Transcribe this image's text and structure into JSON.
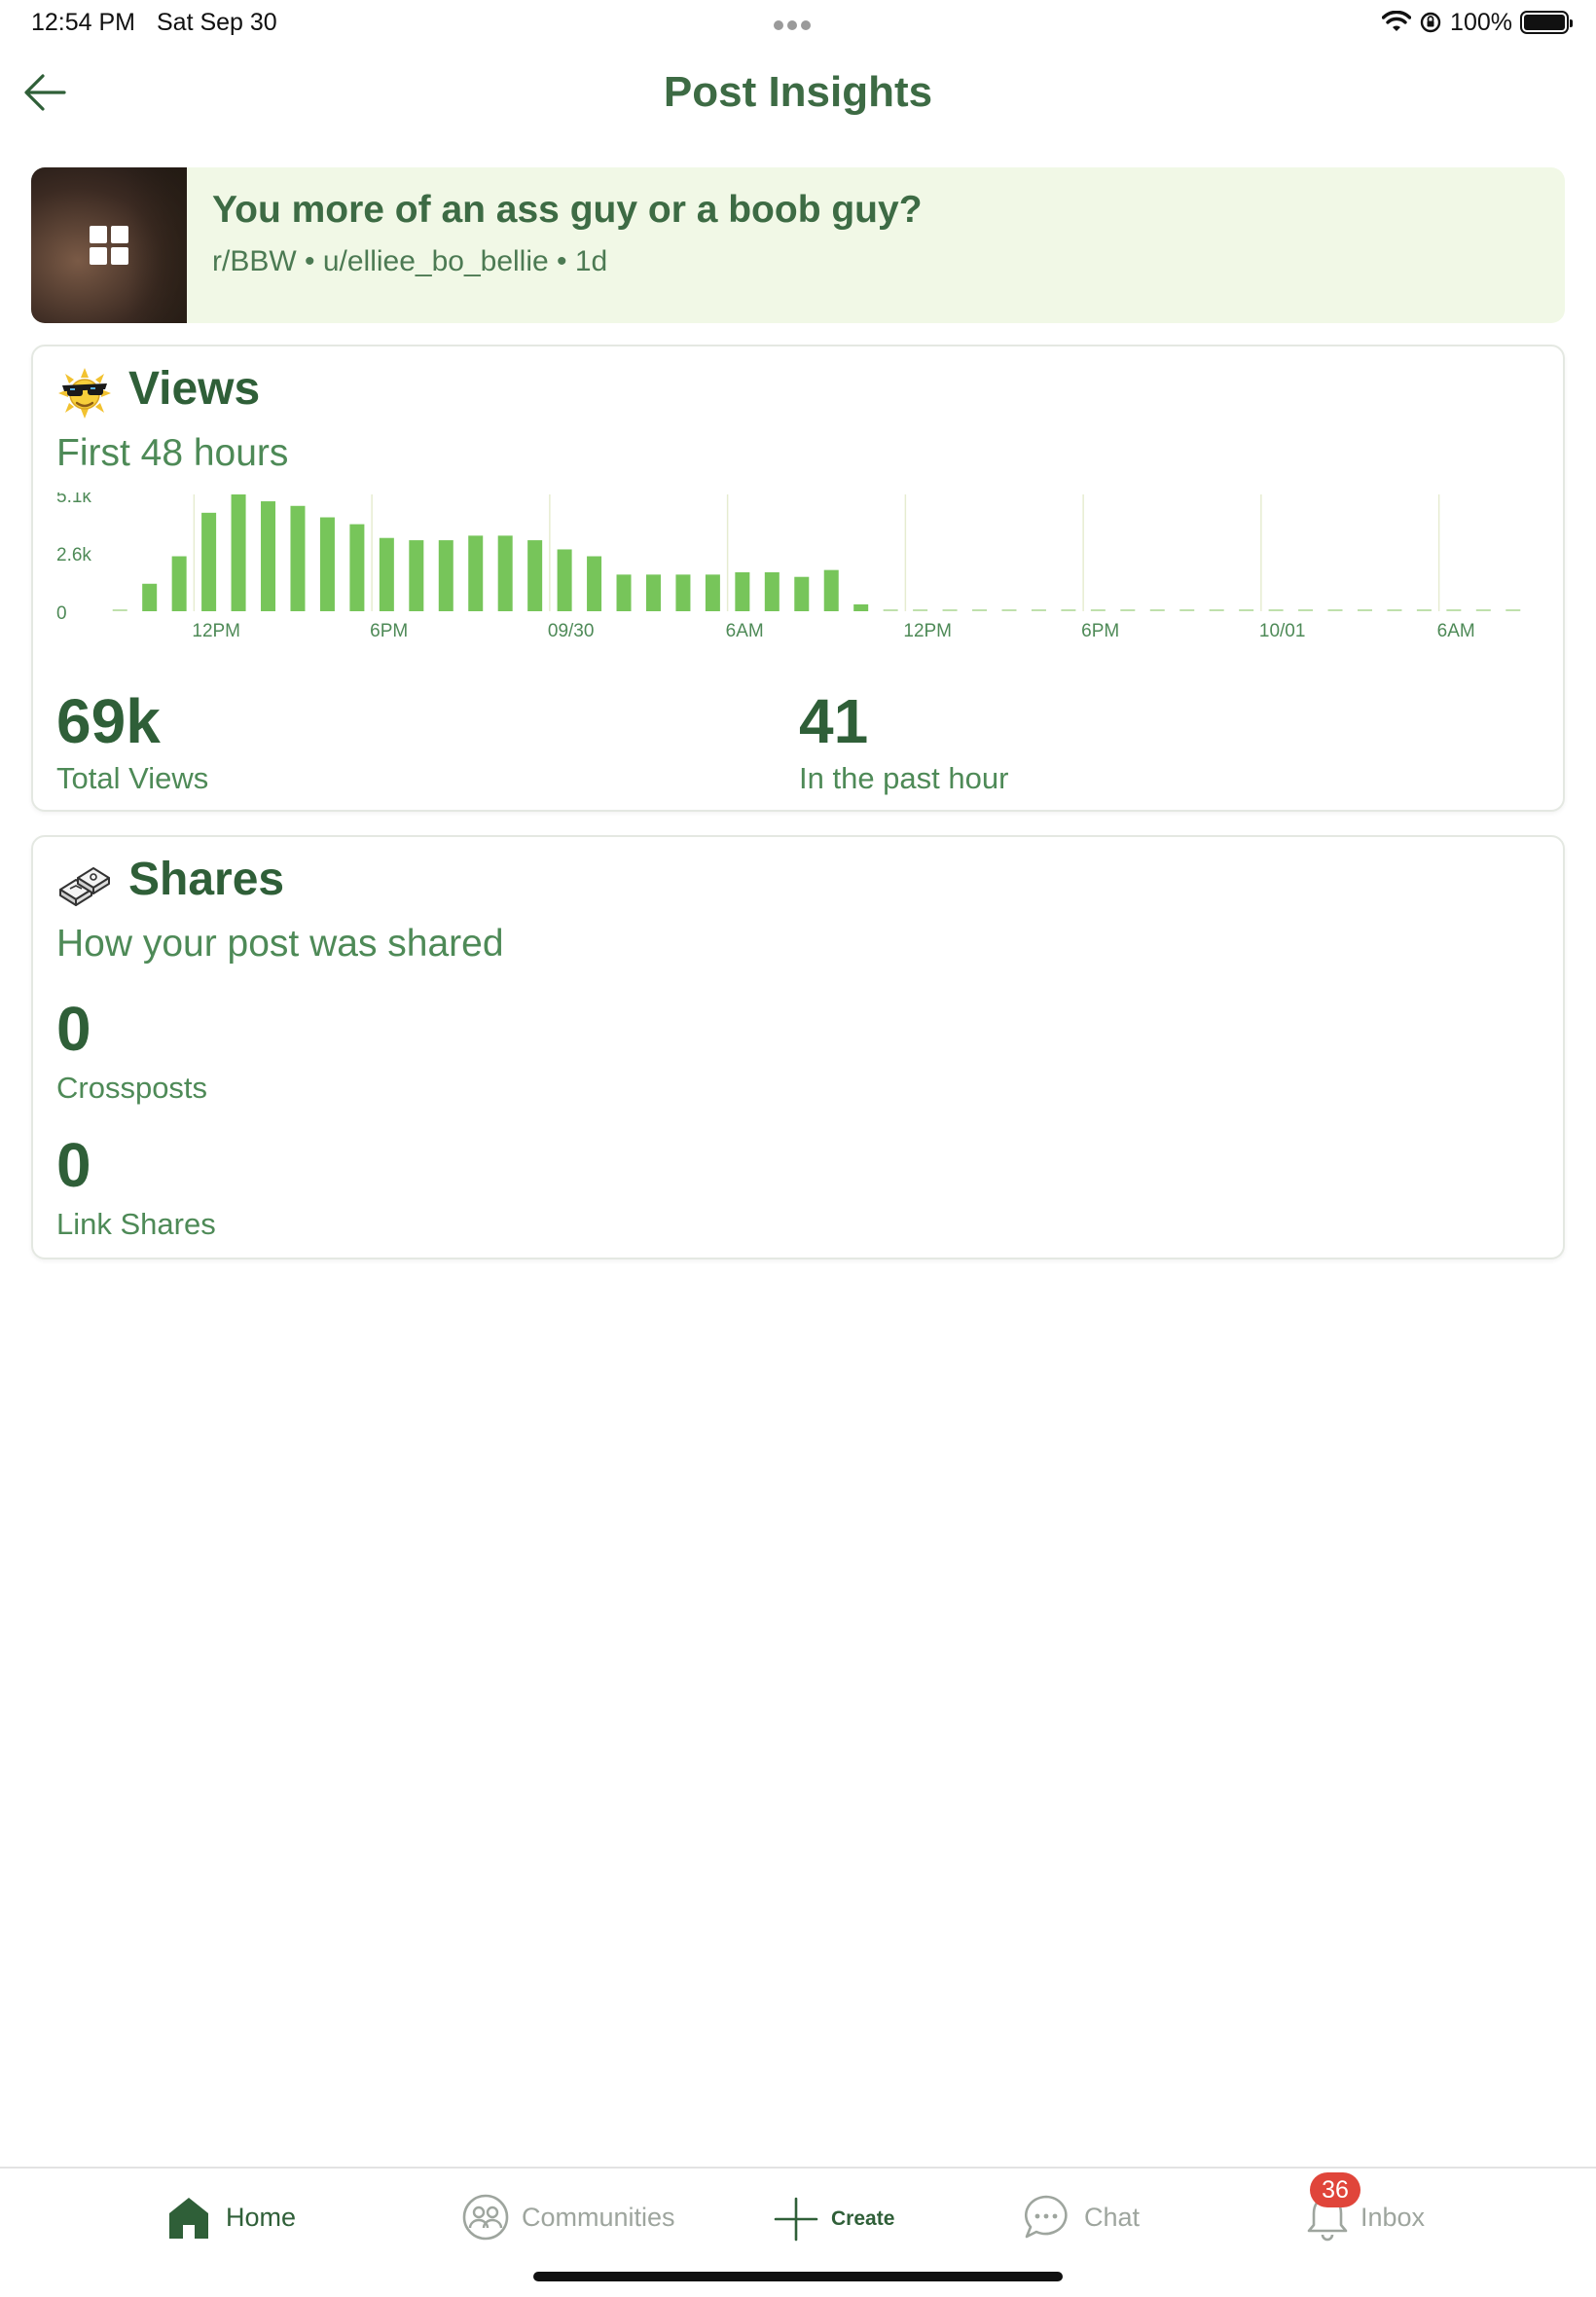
{
  "status_bar": {
    "time": "12:54 PM",
    "date": "Sat Sep 30",
    "battery_text": "100%",
    "battery_level": 1.0
  },
  "header": {
    "title": "Post Insights",
    "back_icon": "arrow-left-icon"
  },
  "post": {
    "title": "You more of an ass guy or a boob guy?",
    "meta": "r/BBW • u/elliee_bo_bellie • 1d",
    "thumbnail_icon": "gallery-icon"
  },
  "views": {
    "title": "Views",
    "subtitle": "First 48 hours",
    "total_value": "69k",
    "total_label": "Total Views",
    "past_hour_value": "41",
    "past_hour_label": "In the past hour"
  },
  "shares": {
    "title": "Shares",
    "subtitle": "How your post was shared",
    "crossposts_value": "0",
    "crossposts_label": "Crossposts",
    "link_shares_value": "0",
    "link_shares_label": "Link Shares"
  },
  "chart_data": {
    "type": "bar",
    "title": "",
    "xlabel": "",
    "ylabel": "",
    "y_ticks": [
      "5.1k",
      "2.6k",
      "0"
    ],
    "ylim": [
      0,
      5100
    ],
    "x_tick_labels": [
      "12PM",
      "6PM",
      "09/30",
      "6AM",
      "12PM",
      "6PM",
      "10/01",
      "6AM"
    ],
    "bar_color": "#77c55a",
    "values": [
      0,
      1200,
      2400,
      4300,
      5100,
      4800,
      4600,
      4100,
      3800,
      3200,
      3100,
      3100,
      3300,
      3300,
      3100,
      2700,
      2400,
      1600,
      1600,
      1600,
      1600,
      1700,
      1700,
      1500,
      1800,
      300,
      0,
      0,
      0,
      0,
      0,
      0,
      0,
      0,
      0,
      0,
      0,
      0,
      0,
      0,
      0,
      0,
      0,
      0,
      0,
      0,
      0,
      0
    ],
    "grid": "vertical"
  },
  "nav": {
    "items": [
      {
        "label": "Home",
        "icon": "home-icon"
      },
      {
        "label": "Communities",
        "icon": "communities-icon"
      },
      {
        "label": "Create",
        "icon": "plus-icon"
      },
      {
        "label": "Chat",
        "icon": "chat-icon"
      },
      {
        "label": "Inbox",
        "icon": "bell-icon"
      }
    ],
    "inbox_badge": "36",
    "colors": {
      "active": "#2f5f38",
      "inactive": "#9ea59e",
      "badge": "#e0453a"
    }
  }
}
